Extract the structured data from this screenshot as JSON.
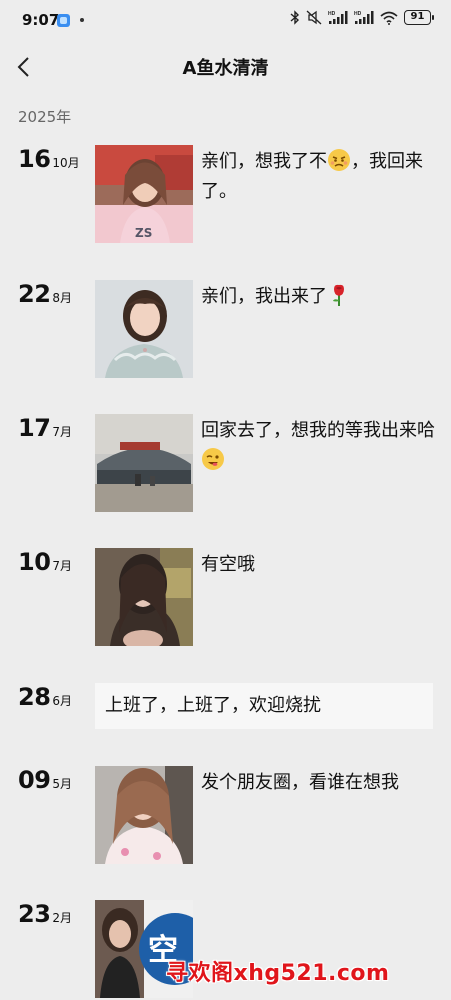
{
  "status_bar": {
    "time": "9:07",
    "battery": "91",
    "icons": [
      "app-notification-icon",
      "bluetooth-icon",
      "mute-icon",
      "hd-signal-icon",
      "hd-signal-icon",
      "wifi-icon",
      "battery-icon"
    ]
  },
  "nav": {
    "back_icon": "chevron-left-icon",
    "title": "A鱼水清清"
  },
  "year": "2025年",
  "posts": [
    {
      "day": "16",
      "month": "10月",
      "text": "亲们，想我了不",
      "emoji": "pouting-face-emoji",
      "text_after": "，我回来了。"
    },
    {
      "day": "22",
      "month": "8月",
      "text": "亲们，我出来了",
      "emoji": "rose-emoji"
    },
    {
      "day": "17",
      "month": "7月",
      "text": "回家去了，想我的等我出来哈",
      "emoji": "winking-face-emoji"
    },
    {
      "day": "10",
      "month": "7月",
      "text": "有空哦"
    },
    {
      "day": "28",
      "month": "6月",
      "text": "上班了，上班了，欢迎烧扰"
    },
    {
      "day": "09",
      "month": "5月",
      "text": "发个朋友圈，看谁在想我"
    },
    {
      "day": "23",
      "month": "2月",
      "thumb_sign_text": "空"
    }
  ],
  "watermark": "寻欢阁xhg521.com",
  "colors": {
    "background": "#ededed",
    "text_card": "#f7f7f7",
    "watermark": "#e0151b",
    "text": "#111111"
  }
}
